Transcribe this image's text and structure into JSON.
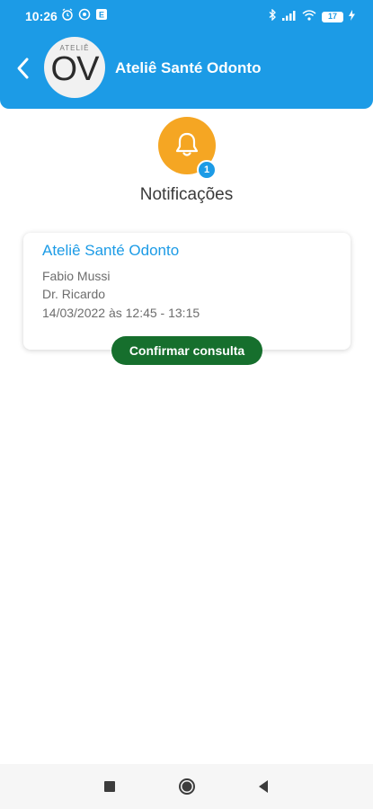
{
  "status_bar": {
    "time": "10:26",
    "battery": "17",
    "left_icons": [
      "alarm-icon",
      "whatsapp-icon",
      "app-icon"
    ],
    "right_icons": [
      "bluetooth-icon",
      "signal-icon",
      "wifi-icon",
      "battery-icon",
      "charging-icon"
    ]
  },
  "header": {
    "title": "Ateliê Santé Odonto",
    "logo_small": "ATELIÊ",
    "logo_big": "OV",
    "background_color": "#1c9be6",
    "back_icon": "chevron-left-icon"
  },
  "notifications": {
    "title": "Notificações",
    "badge_count": "1",
    "icon": "bell-icon",
    "icon_color": "#f5a623"
  },
  "card": {
    "clinic": "Ateliê Santé Odonto",
    "patient": "Fabio Mussi",
    "doctor": "Dr. Ricardo",
    "datetime": "14/03/2022 às 12:45 - 13:15",
    "confirm_label": "Confirmar consulta",
    "confirm_color": "#166f2d"
  },
  "navbar": {
    "icons": [
      "recent-apps-icon",
      "home-icon",
      "back-icon"
    ]
  }
}
